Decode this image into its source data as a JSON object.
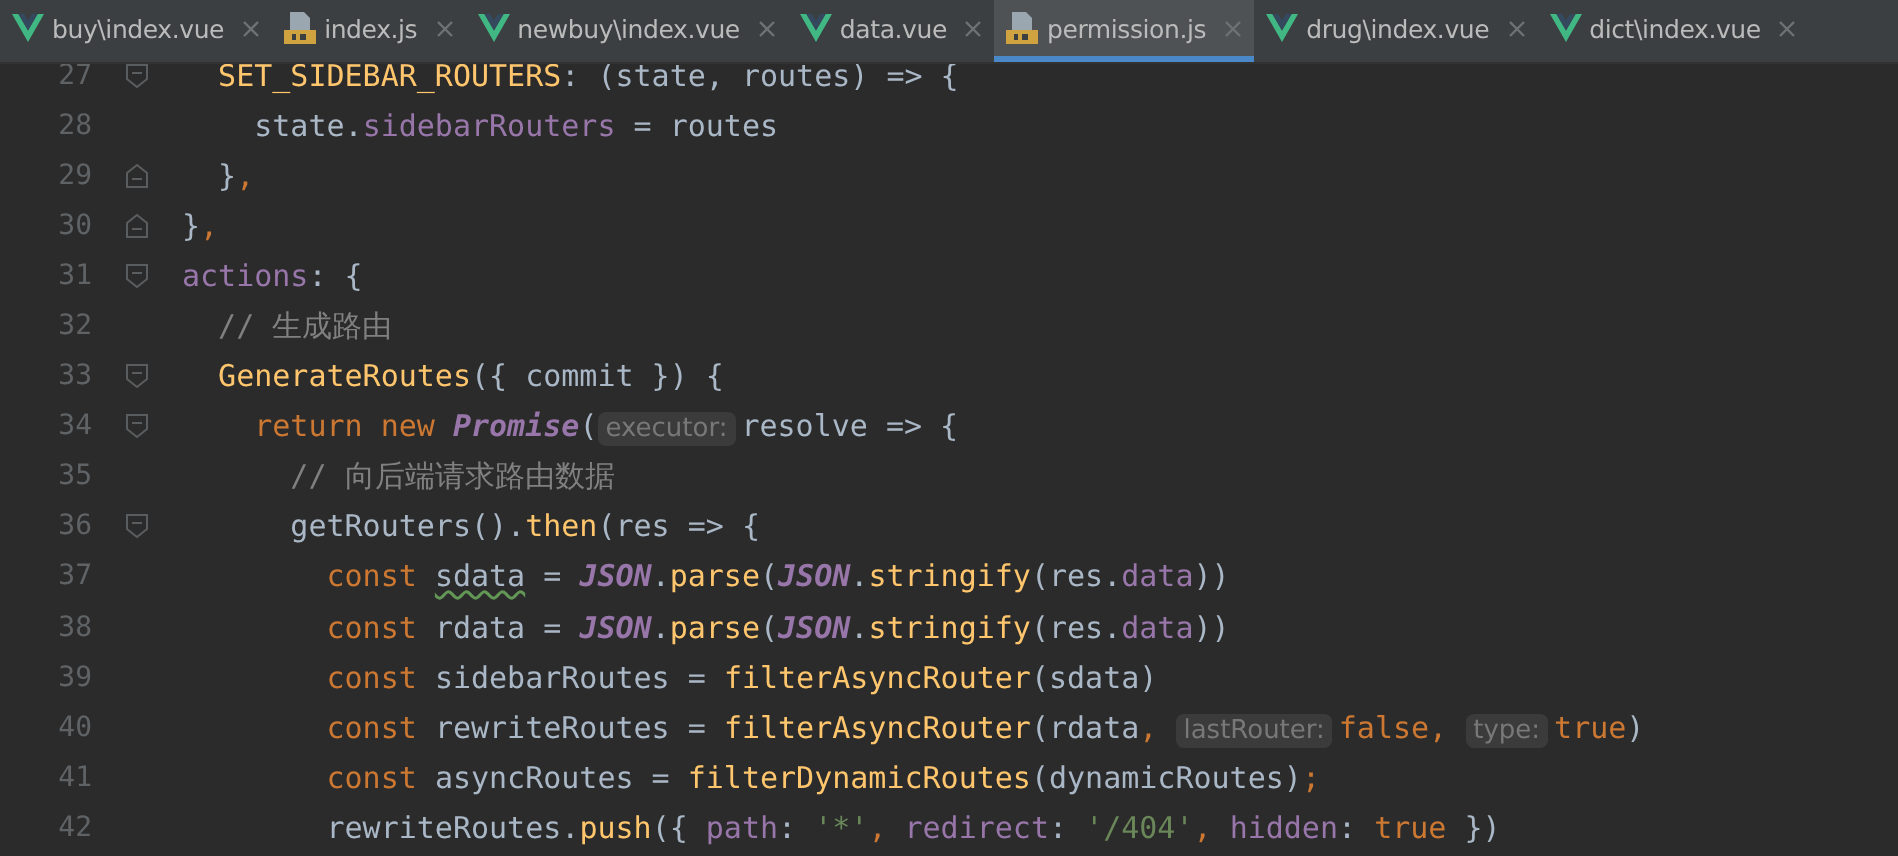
{
  "tabs": [
    {
      "label": "buy\\index.vue",
      "kind": "vue",
      "selected": false
    },
    {
      "label": "index.js",
      "kind": "js",
      "selected": false
    },
    {
      "label": "newbuy\\index.vue",
      "kind": "vue",
      "selected": false
    },
    {
      "label": "data.vue",
      "kind": "vue",
      "selected": false
    },
    {
      "label": "permission.js",
      "kind": "js",
      "selected": true
    },
    {
      "label": "drug\\index.vue",
      "kind": "vue",
      "selected": false
    },
    {
      "label": "dict\\index.vue",
      "kind": "vue",
      "selected": false
    }
  ],
  "lines": [
    {
      "number": "27",
      "fold_open": true,
      "tokens": [
        {
          "kind": "function",
          "text": "  SET_SIDEBAR_ROUTERS"
        },
        {
          "kind": "plain",
          "text": ": (state, routes) => {"
        }
      ]
    },
    {
      "number": "28",
      "tokens": [
        {
          "kind": "plain",
          "text": "    state."
        },
        {
          "kind": "property",
          "text": "sidebarRouters"
        },
        {
          "kind": "plain",
          "text": " = routes"
        }
      ]
    },
    {
      "number": "29",
      "fold_close": true,
      "tokens": [
        {
          "kind": "plain",
          "text": "  }"
        },
        {
          "kind": "keyword",
          "text": ","
        }
      ]
    },
    {
      "number": "30",
      "fold_close": true,
      "tokens": [
        {
          "kind": "plain",
          "text": "}"
        },
        {
          "kind": "keyword",
          "text": ","
        }
      ]
    },
    {
      "number": "31",
      "fold_open": true,
      "tokens": [
        {
          "kind": "property",
          "text": "actions"
        },
        {
          "kind": "plain",
          "text": ": {"
        }
      ]
    },
    {
      "number": "32",
      "tokens": [
        {
          "kind": "comment",
          "text": "  // 生成路由"
        }
      ]
    },
    {
      "number": "33",
      "fold_open": true,
      "tokens": [
        {
          "kind": "function",
          "text": "  GenerateRoutes"
        },
        {
          "kind": "plain",
          "text": "({ commit }) {"
        }
      ]
    },
    {
      "number": "34",
      "fold_open": true,
      "tokens": [
        {
          "kind": "keyword",
          "text": "    return new "
        },
        {
          "kind": "class",
          "text": "Promise"
        },
        {
          "kind": "plain",
          "text": "("
        },
        {
          "kind": "hint",
          "text": "executor:"
        },
        {
          "kind": "plain",
          "text": "resolve => {"
        }
      ]
    },
    {
      "number": "35",
      "tokens": [
        {
          "kind": "comment",
          "text": "      // 向后端请求路由数据"
        }
      ]
    },
    {
      "number": "36",
      "fold_open": true,
      "tokens": [
        {
          "kind": "plain",
          "text": "      getRouters()."
        },
        {
          "kind": "function",
          "text": "then"
        },
        {
          "kind": "plain",
          "text": "(res => {"
        }
      ]
    },
    {
      "number": "37",
      "tokens": [
        {
          "kind": "keyword",
          "text": "        const "
        },
        {
          "kind": "warning",
          "text": "sdata"
        },
        {
          "kind": "plain",
          "text": " = "
        },
        {
          "kind": "class",
          "text": "JSON"
        },
        {
          "kind": "plain",
          "text": "."
        },
        {
          "kind": "function",
          "text": "parse"
        },
        {
          "kind": "plain",
          "text": "("
        },
        {
          "kind": "class",
          "text": "JSON"
        },
        {
          "kind": "plain",
          "text": "."
        },
        {
          "kind": "function",
          "text": "stringify"
        },
        {
          "kind": "plain",
          "text": "(res."
        },
        {
          "kind": "property",
          "text": "data"
        },
        {
          "kind": "plain",
          "text": "))"
        }
      ]
    },
    {
      "number": "38",
      "tokens": [
        {
          "kind": "keyword",
          "text": "        const "
        },
        {
          "kind": "plain",
          "text": "rdata = "
        },
        {
          "kind": "class",
          "text": "JSON"
        },
        {
          "kind": "plain",
          "text": "."
        },
        {
          "kind": "function",
          "text": "parse"
        },
        {
          "kind": "plain",
          "text": "("
        },
        {
          "kind": "class",
          "text": "JSON"
        },
        {
          "kind": "plain",
          "text": "."
        },
        {
          "kind": "function",
          "text": "stringify"
        },
        {
          "kind": "plain",
          "text": "(res."
        },
        {
          "kind": "property",
          "text": "data"
        },
        {
          "kind": "plain",
          "text": "))"
        }
      ]
    },
    {
      "number": "39",
      "tokens": [
        {
          "kind": "keyword",
          "text": "        const "
        },
        {
          "kind": "plain",
          "text": "sidebarRoutes = "
        },
        {
          "kind": "function",
          "text": "filterAsyncRouter"
        },
        {
          "kind": "plain",
          "text": "(sdata)"
        }
      ]
    },
    {
      "number": "40",
      "tokens": [
        {
          "kind": "keyword",
          "text": "        const "
        },
        {
          "kind": "plain",
          "text": "rewriteRoutes = "
        },
        {
          "kind": "function",
          "text": "filterAsyncRouter"
        },
        {
          "kind": "plain",
          "text": "(rdata"
        },
        {
          "kind": "keyword",
          "text": ", "
        },
        {
          "kind": "hint",
          "text": "lastRouter:"
        },
        {
          "kind": "keyword",
          "text": "false, "
        },
        {
          "kind": "hint",
          "text": "type:"
        },
        {
          "kind": "keyword",
          "text": "true"
        },
        {
          "kind": "plain",
          "text": ")"
        }
      ]
    },
    {
      "number": "41",
      "tokens": [
        {
          "kind": "keyword",
          "text": "        const "
        },
        {
          "kind": "plain",
          "text": "asyncRoutes = "
        },
        {
          "kind": "function",
          "text": "filterDynamicRoutes"
        },
        {
          "kind": "plain",
          "text": "(dynamicRoutes)"
        },
        {
          "kind": "keyword",
          "text": ";"
        }
      ]
    },
    {
      "number": "42",
      "tokens": [
        {
          "kind": "plain",
          "text": "        rewriteRoutes."
        },
        {
          "kind": "function",
          "text": "push"
        },
        {
          "kind": "plain",
          "text": "({ "
        },
        {
          "kind": "property",
          "text": "path"
        },
        {
          "kind": "plain",
          "text": ": "
        },
        {
          "kind": "string",
          "text": "'*'"
        },
        {
          "kind": "keyword",
          "text": ", "
        },
        {
          "kind": "property",
          "text": "redirect"
        },
        {
          "kind": "plain",
          "text": ": "
        },
        {
          "kind": "string",
          "text": "'/404'"
        },
        {
          "kind": "keyword",
          "text": ", "
        },
        {
          "kind": "property",
          "text": "hidden"
        },
        {
          "kind": "plain",
          "text": ": "
        },
        {
          "kind": "keyword",
          "text": "true "
        },
        {
          "kind": "plain",
          "text": "})"
        }
      ]
    }
  ]
}
